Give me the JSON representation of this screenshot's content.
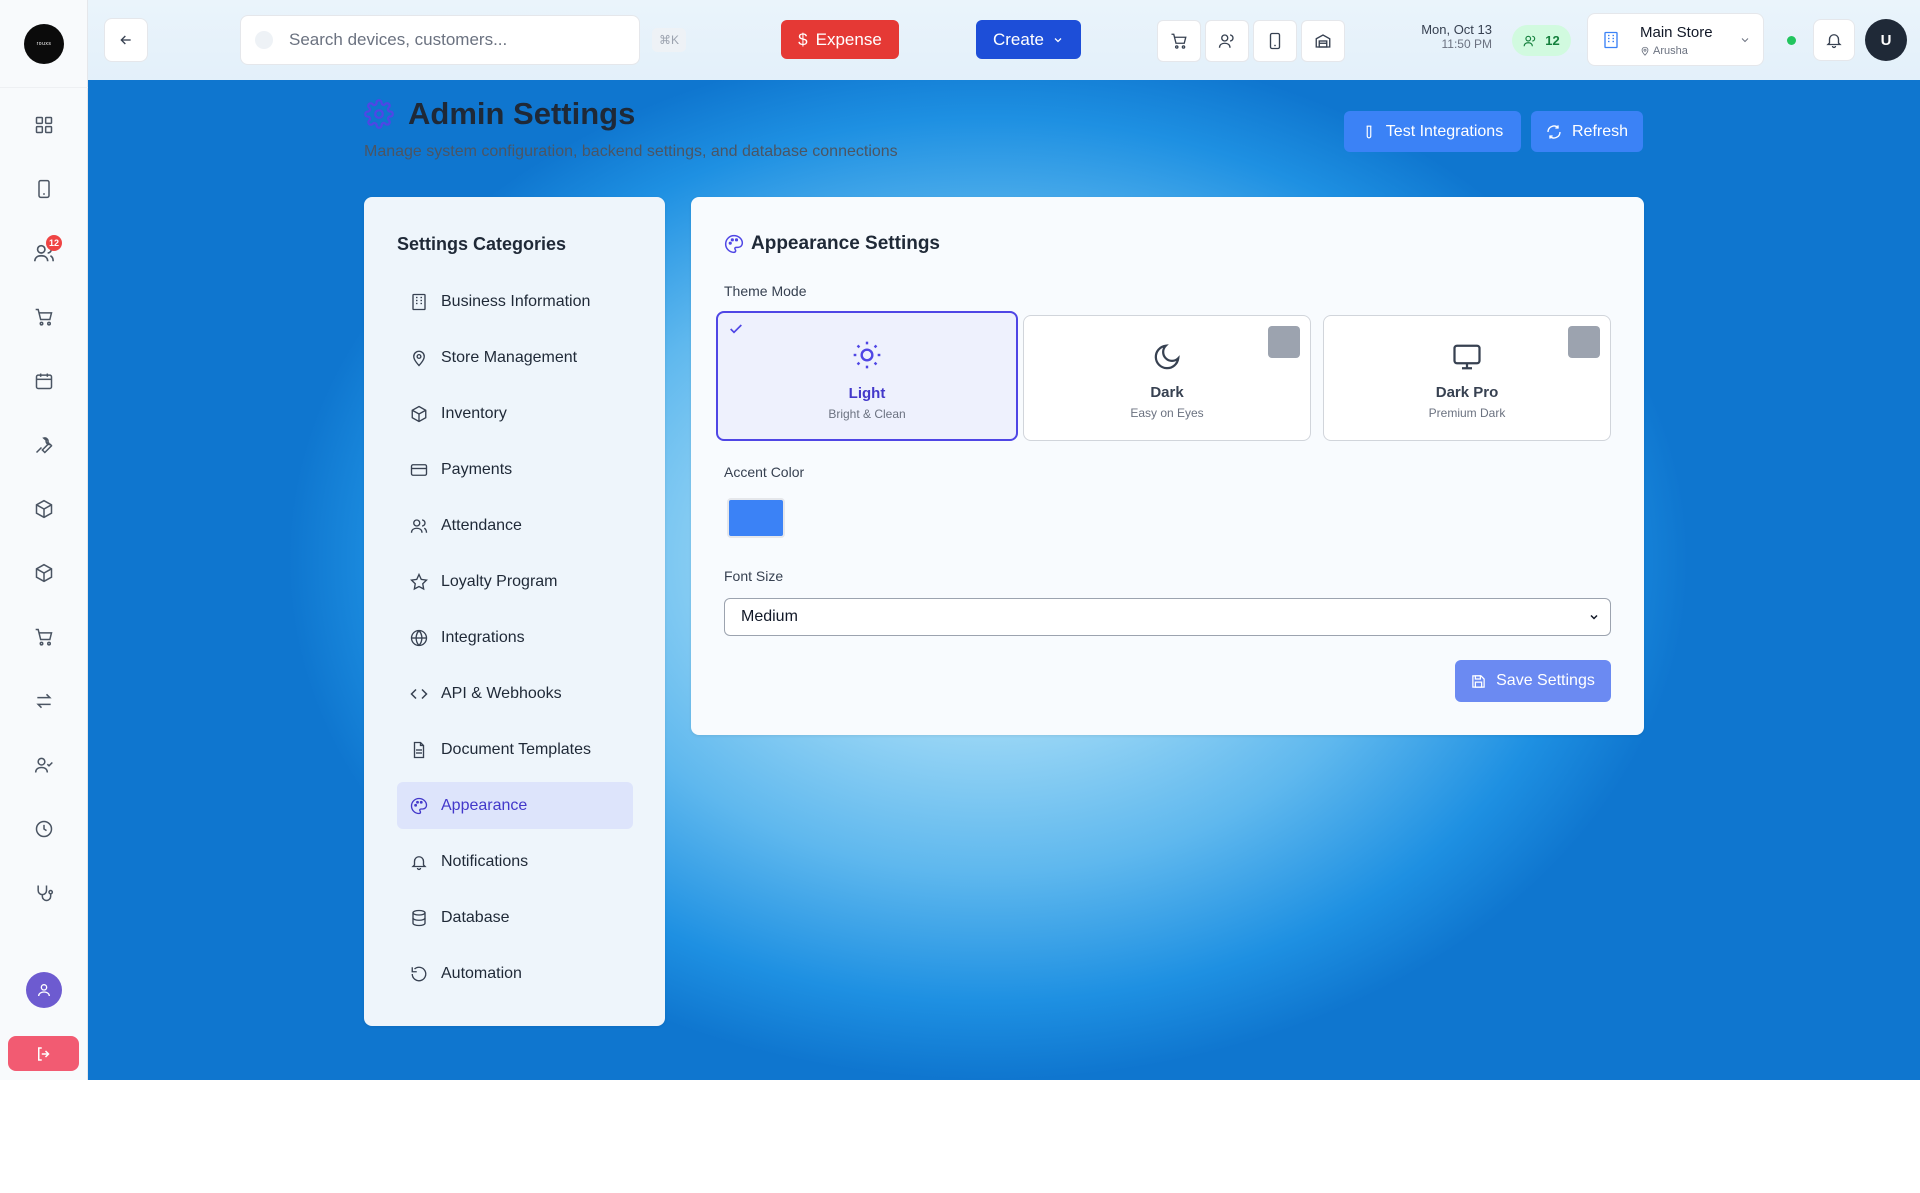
{
  "sidebar": {
    "logo_text": "rouxs",
    "badge_count": "12",
    "items": [
      "dashboard-icon",
      "tablet-icon",
      "customers-icon",
      "cart-icon",
      "calendar-icon",
      "wrench-icon",
      "package-icon",
      "package-icon",
      "cart-icon",
      "transfer-icon",
      "user-check-icon",
      "clock-icon",
      "stethoscope-icon"
    ]
  },
  "topbar": {
    "search_placeholder": "Search devices, customers...",
    "shortcut": "⌘K",
    "expense_label": "Expense",
    "create_label": "Create",
    "date": "Mon, Oct 13",
    "time": "11:50 PM",
    "online_count": "12",
    "store_name": "Main Store",
    "store_location": "Arusha",
    "user_initial": "U"
  },
  "header": {
    "title": "Admin Settings",
    "subtitle": "Manage system configuration, backend settings, and database connections",
    "test_label": "Test Integrations",
    "refresh_label": "Refresh"
  },
  "categories": {
    "title": "Settings Categories",
    "items": [
      {
        "label": "Business Information"
      },
      {
        "label": "Store Management"
      },
      {
        "label": "Inventory"
      },
      {
        "label": "Payments"
      },
      {
        "label": "Attendance"
      },
      {
        "label": "Loyalty Program"
      },
      {
        "label": "Integrations"
      },
      {
        "label": "API & Webhooks"
      },
      {
        "label": "Document Templates"
      },
      {
        "label": "Appearance"
      },
      {
        "label": "Notifications"
      },
      {
        "label": "Database"
      },
      {
        "label": "Automation"
      }
    ],
    "active": "Appearance"
  },
  "appearance": {
    "title": "Appearance Settings",
    "theme_label": "Theme Mode",
    "themes": [
      {
        "name": "Light",
        "desc": "Bright & Clean"
      },
      {
        "name": "Dark",
        "desc": "Easy on Eyes"
      },
      {
        "name": "Dark Pro",
        "desc": "Premium Dark"
      }
    ],
    "selected_theme": "Light",
    "accent_label": "Accent Color",
    "accent_color": "#3b82f6",
    "font_label": "Font Size",
    "font_value": "Medium",
    "save_label": "Save Settings"
  }
}
